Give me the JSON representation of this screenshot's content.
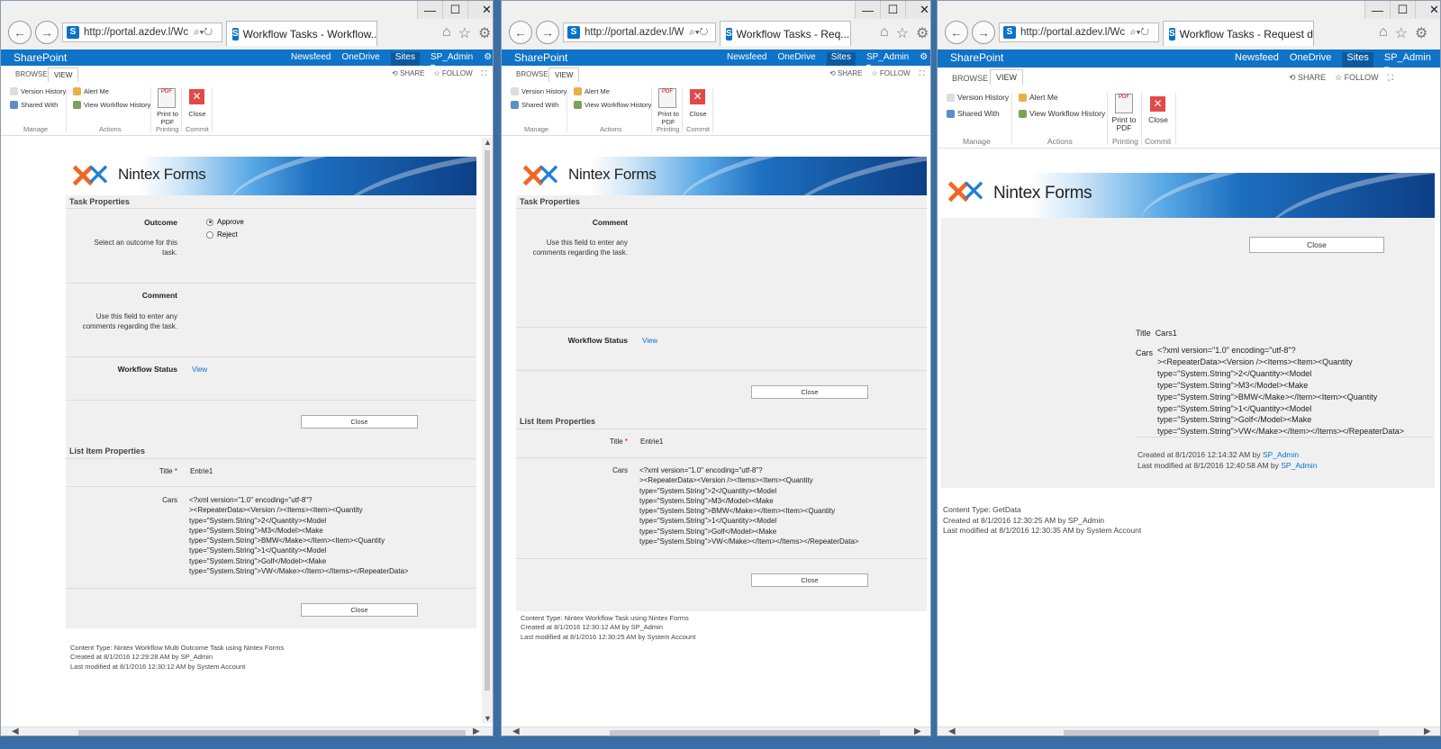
{
  "windows": [
    {
      "id": "w1",
      "address": "http://portal.azdev.l/Wc",
      "tab_title": "Workflow Tasks - Workflow...",
      "site": "SharePoint",
      "nav": [
        "Newsfeed",
        "OneDrive",
        "Sites"
      ],
      "user": "SP_Admin ▾",
      "ribbon_tabs": [
        "BROWSE",
        "VIEW"
      ],
      "ribbon_right": [
        "SHARE",
        "FOLLOW"
      ],
      "ribbon": {
        "version_history": "Version History",
        "shared_with": "Shared With",
        "alert_me": "Alert Me",
        "view_wf_history": "View Workflow History",
        "print_pdf_1": "Print to",
        "print_pdf_2": "PDF",
        "close": "Close",
        "grp_manage": "Manage",
        "grp_actions": "Actions",
        "grp_printing": "Printing",
        "grp_commit": "Commit"
      },
      "brand": "Nintex Forms",
      "task_properties": "Task Properties",
      "outcome_label": "Outcome",
      "outcome_hint": "Select an outcome for this task.",
      "outcome_options": [
        "Approve",
        "Reject"
      ],
      "comment_label": "Comment",
      "comment_hint": "Use this field to enter any comments regarding the task.",
      "wf_status_label": "Workflow Status",
      "wf_status_link": "View",
      "close_btn": "Close",
      "list_item_properties": "List Item Properties",
      "title_label": "Title",
      "title_value": "Entrie1",
      "cars_label": "Cars",
      "cars_value": "<?xml version=\"1.0\" encoding=\"utf-8\"?\n><RepeaterData><Version /><Items><Item><Quantity\ntype=\"System.String\">2</Quantity><Model\ntype=\"System.String\">M3</Model><Make\ntype=\"System.String\">BMW</Make></Item><Item><Quantity\ntype=\"System.String\">1</Quantity><Model\ntype=\"System.String\">Golf</Model><Make\ntype=\"System.String\">VW</Make></Item></Items></RepeaterData>",
      "meta_1": "Content Type: Nintex Workflow Multi Outcome Task using Nintex Forms",
      "meta_2": "Created at 8/1/2016 12:29:28 AM by SP_Admin",
      "meta_3": "Last modified at 8/1/2016 12:30:12 AM by System Account"
    },
    {
      "id": "w2",
      "address": "http://portal.azdev.l/W",
      "tab_title": "Workflow Tasks - Req...",
      "site": "SharePoint",
      "nav": [
        "Newsfeed",
        "OneDrive",
        "Sites"
      ],
      "user": "SP_Admin ▾",
      "ribbon_tabs": [
        "BROWSE",
        "VIEW"
      ],
      "ribbon_right": [
        "SHARE",
        "FOLLOW"
      ],
      "ribbon": {
        "version_history": "Version History",
        "shared_with": "Shared With",
        "alert_me": "Alert Me",
        "view_wf_history": "View Workflow History",
        "print_pdf_1": "Print to",
        "print_pdf_2": "PDF",
        "close": "Close",
        "grp_manage": "Manage",
        "grp_actions": "Actions",
        "grp_printing": "Printing",
        "grp_commit": "Commit"
      },
      "brand": "Nintex Forms",
      "task_properties": "Task Properties",
      "comment_label": "Comment",
      "comment_hint": "Use this field to enter any comments regarding the task.",
      "wf_status_label": "Workflow Status",
      "wf_status_link": "View",
      "close_btn": "Close",
      "list_item_properties": "List Item Properties",
      "title_label": "Title",
      "title_value": "Entrie1",
      "cars_label": "Cars",
      "cars_value": "<?xml version=\"1.0\" encoding=\"utf-8\"?\n><RepeaterData><Version /><Items><Item><Quantity\ntype=\"System.String\">2</Quantity><Model\ntype=\"System.String\">M3</Model><Make\ntype=\"System.String\">BMW</Make></Item><Item><Quantity\ntype=\"System.String\">1</Quantity><Model\ntype=\"System.String\">Golf</Model><Make\ntype=\"System.String\">VW</Make></Item></Items></RepeaterData>",
      "meta_1": "Content Type: Nintex Workflow Task using Nintex Forms",
      "meta_2": "Created at 8/1/2016 12:30:12 AM by SP_Admin",
      "meta_3": "Last modified at 8/1/2016 12:30:25 AM by System Account"
    },
    {
      "id": "w3",
      "address": "http://portal.azdev.l/Wc",
      "tab_title": "Workflow Tasks - Request d...",
      "site": "SharePoint",
      "nav": [
        "Newsfeed",
        "OneDrive",
        "Sites"
      ],
      "user": "SP_Admin ▾",
      "ribbon_tabs": [
        "BROWSE",
        "VIEW"
      ],
      "ribbon_right": [
        "SHARE",
        "FOLLOW"
      ],
      "ribbon": {
        "version_history": "Version History",
        "shared_with": "Shared With",
        "alert_me": "Alert Me",
        "view_wf_history": "View Workflow History",
        "print_pdf_1": "Print to",
        "print_pdf_2": "PDF",
        "close": "Close",
        "grp_manage": "Manage",
        "grp_actions": "Actions",
        "grp_printing": "Printing",
        "grp_commit": "Commit"
      },
      "brand": "Nintex Forms",
      "close_btn": "Close",
      "title_label": "Title",
      "title_value": "Cars1",
      "cars_label": "Cars",
      "cars_value": "<?xml version=\"1.0\" encoding=\"utf-8\"?\n><RepeaterData><Version /><Items><Item><Quantity\ntype=\"System.String\">2</Quantity><Model\ntype=\"System.String\">M3</Model><Make\ntype=\"System.String\">BMW</Make></Item><Item><Quantity\ntype=\"System.String\">1</Quantity><Model\ntype=\"System.String\">Golf</Model><Make\ntype=\"System.String\">VW</Make></Item></Items></RepeaterData>",
      "item_meta_1": "Created at 8/1/2016 12:14:32 AM by",
      "item_meta_1_user": "SP_Admin",
      "item_meta_2": "Last modified at 8/1/2016 12:40:58 AM by",
      "item_meta_2_user": "SP_Admin",
      "meta_1": "Content Type: GetData",
      "meta_2": "Created at 8/1/2016 12:30:25 AM by SP_Admin",
      "meta_3": "Last modified at 8/1/2016 12:30:35 AM by System Account"
    }
  ],
  "window_controls": [
    "—",
    "☐",
    "✕"
  ],
  "colors": {
    "sharepoint_blue": "#0f73c8",
    "form_bg": "#f0f0f0",
    "link": "#0a72c9",
    "desktop": "#3a6ea5"
  }
}
